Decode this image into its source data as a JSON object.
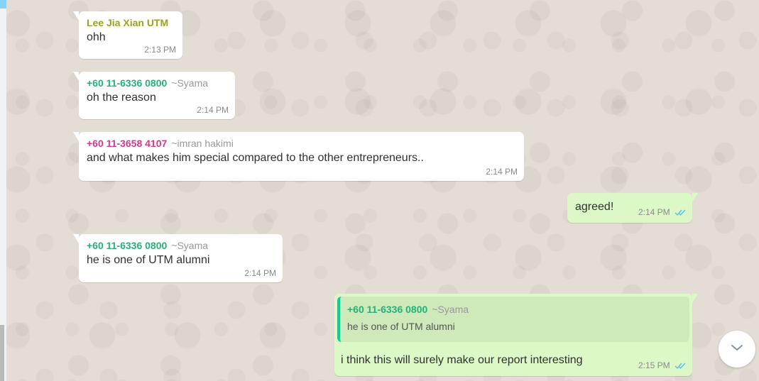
{
  "colors": {
    "wallpaper": "#e4ddd5",
    "incoming_bubble": "#ffffff",
    "outgoing_bubble": "#dcf8c6",
    "read_ticks": "#4fc3f7"
  },
  "messages": [
    {
      "sender": "Lee Jia Xian UTM",
      "sender_color": "#9aa31a",
      "alias": "",
      "text": "ohh",
      "time": "2:13 PM"
    },
    {
      "sender": "+60 11-6336 0800",
      "sender_color": "#24b07a",
      "alias": "~Syama",
      "text": "oh the reason",
      "time": "2:14 PM"
    },
    {
      "sender": "+60 11-3658 4107",
      "sender_color": "#d4388f",
      "alias": "~imran hakimi",
      "text": "and what makes him special compared to the other entrepreneurs..",
      "time": "2:14 PM"
    },
    {
      "sender": "",
      "alias": "",
      "text": "agreed!",
      "time": "2:14 PM",
      "outgoing": true
    },
    {
      "sender": "+60 11-6336 0800",
      "sender_color": "#24b07a",
      "alias": "~Syama",
      "text": "he is one of UTM alumni",
      "time": "2:14 PM"
    },
    {
      "outgoing": true,
      "quote": {
        "sender": "+60 11-6336 0800",
        "sender_color": "#24b07a",
        "alias": "~Syama",
        "text": "he is one of UTM alumni"
      },
      "text": "i think this will surely make our report interesting",
      "time": "2:15 PM"
    }
  ],
  "icons": {
    "read_receipt": "double-check-icon",
    "scroll_down": "chevron-down-icon"
  }
}
